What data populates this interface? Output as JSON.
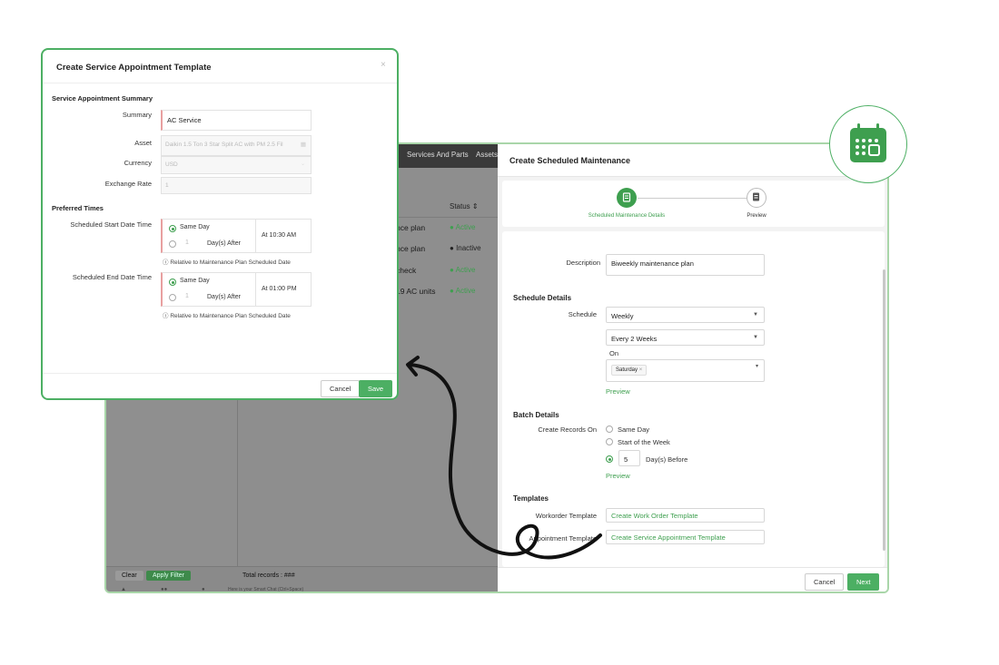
{
  "background_app": {
    "nav": [
      "Services And Parts",
      "Assets"
    ],
    "table_header": {
      "status": "Status",
      "sort_icon": "sort-icon"
    },
    "rows": [
      {
        "name": "nce plan",
        "status": "Active"
      },
      {
        "name": "nce plan",
        "status": "Inactive"
      },
      {
        "name": "check",
        "status": "Active"
      },
      {
        "name": "19 AC units",
        "status": "Active"
      }
    ],
    "footer": {
      "clear": "Clear",
      "apply_filter": "Apply Filter",
      "total_records": "Total records : ###",
      "smart_chat": "Here is your Smart Chat (Ctrl+Space)"
    },
    "status_colors": {
      "Active": "#3e9f4f",
      "Inactive": "#333333"
    }
  },
  "scheduled_maintenance": {
    "title": "Create Scheduled Maintenance",
    "steps": [
      {
        "label": "Scheduled Maintenance Details",
        "icon": "document-icon",
        "active": true
      },
      {
        "label": "Preview",
        "icon": "document-icon",
        "active": false
      }
    ],
    "description": {
      "label": "Description",
      "value": "Biweekly maintenance plan"
    },
    "schedule_details": {
      "heading": "Schedule Details",
      "schedule_label": "Schedule",
      "frequency": "Weekly",
      "interval": "Every 2 Weeks",
      "on_label": "On",
      "days": [
        "Saturday"
      ],
      "preview_link": "Preview"
    },
    "batch_details": {
      "heading": "Batch Details",
      "create_records_label": "Create Records On",
      "options": [
        "Same Day",
        "Start of the Week"
      ],
      "days_value": "5",
      "days_suffix": "Day(s) Before",
      "preview_link": "Preview"
    },
    "templates": {
      "heading": "Templates",
      "workorder_label": "Workorder Template",
      "workorder_link": "Create Work Order Template",
      "appointment_label": "Appointment Template",
      "appointment_link": "Create Service Appointment Template"
    },
    "cancel": "Cancel",
    "next": "Next"
  },
  "service_appointment_modal": {
    "title": "Create Service Appointment Template",
    "close": "×",
    "summary_section": "Service Appointment Summary",
    "summary_label": "Summary",
    "summary_value": "AC Service",
    "asset_label": "Asset",
    "asset_value": "Daikin 1.5 Ton 3 Star Split AC with PM 2.5 Fil",
    "currency_label": "Currency",
    "currency_value": "USD",
    "exchange_rate_label": "Exchange Rate",
    "exchange_rate_value": "1",
    "preferred_times": "Preferred Times",
    "start_label": "Scheduled Start Date Time",
    "end_label": "Scheduled End Date Time",
    "same_day": "Same Day",
    "days_after_value": "1",
    "days_after": "Day(s) After",
    "start_time": "At  10:30 AM",
    "end_time": "At  01:00 PM",
    "relative_note": "Relative to Maintenance Plan Scheduled Date",
    "cancel": "Cancel",
    "save": "Save"
  },
  "accent_color": "#4caf63"
}
